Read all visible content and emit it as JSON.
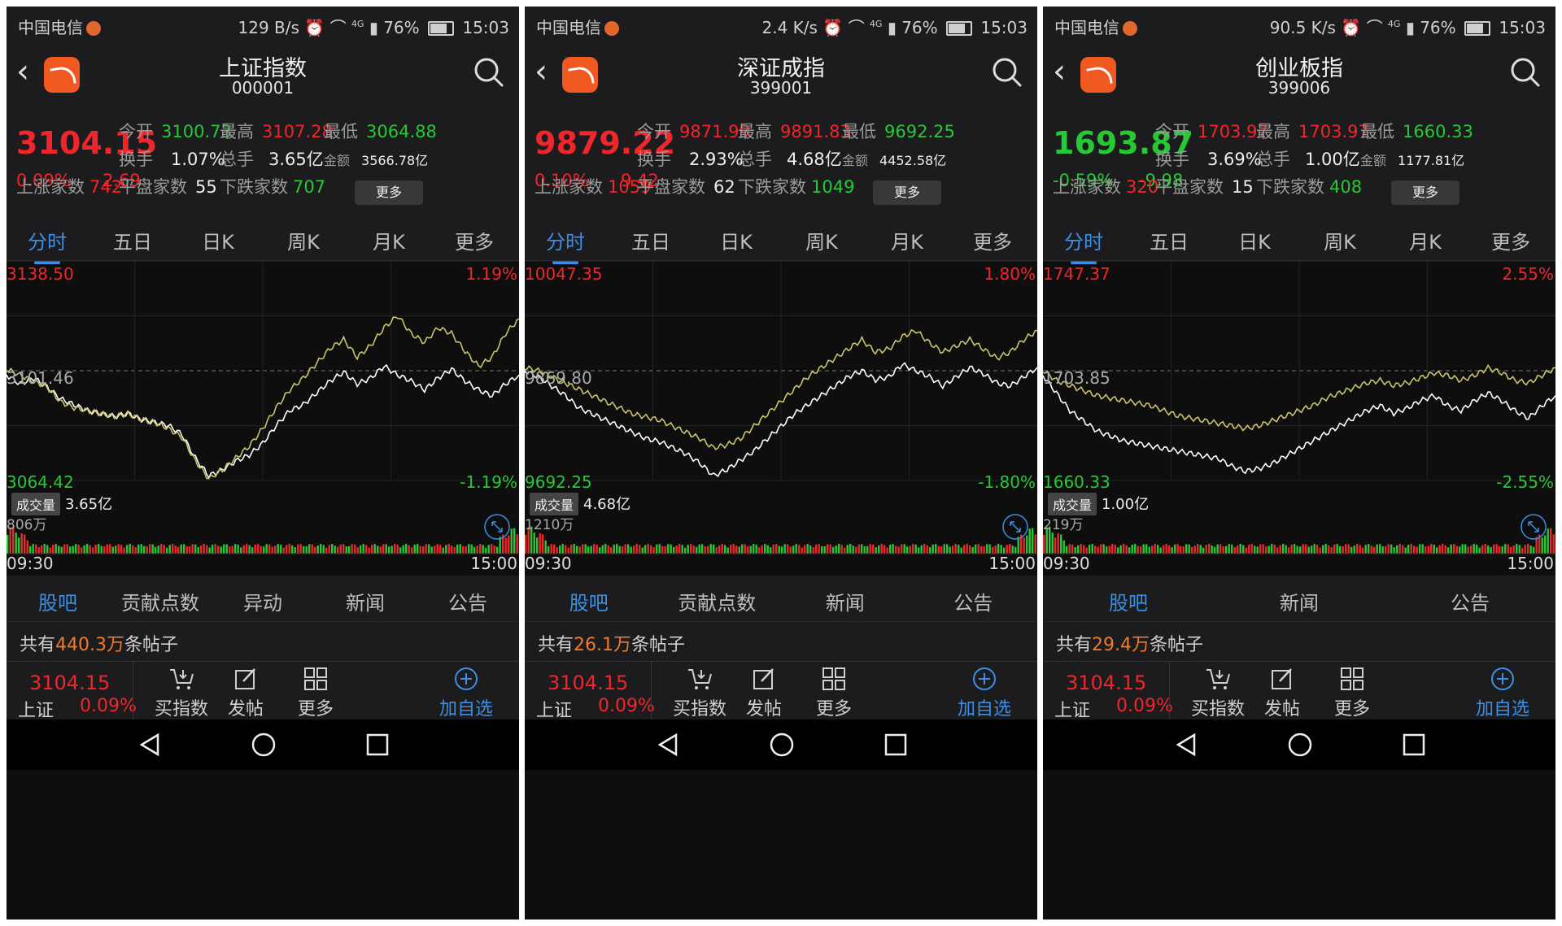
{
  "colors": {
    "up": "#f0262b",
    "down": "#26c934",
    "accent": "#3d8fe6",
    "white_line": "#ffffff",
    "yellow_line": "#c9c36a"
  },
  "common": {
    "carrier": "中国电信",
    "battery": "76%",
    "time": "15:03",
    "network": "4G",
    "stat_labels": {
      "open": "今开",
      "high": "最高",
      "low": "最低",
      "turnover_rate": "换手",
      "total_vol": "总手",
      "amount": "金额",
      "up_count": "上涨家数",
      "flat_count": "平盘家数",
      "down_count": "下跌家数"
    },
    "more_button": "更多",
    "chart_tabs": [
      "分时",
      "五日",
      "日K",
      "周K",
      "月K",
      "更多"
    ],
    "volume_label": "成交量",
    "time_start": "09:30",
    "time_end": "15:00",
    "posts_prefix": "共有",
    "posts_suffix": "条帖子",
    "action_bar": {
      "price": "3104.15",
      "name": "上证",
      "pct": "0.09%",
      "buy": "买指数",
      "post": "发帖",
      "more": "更多",
      "add": "加自选"
    },
    "icons": [
      "back-icon",
      "app-logo-icon",
      "search-icon",
      "expand-icon",
      "cart-icon",
      "edit-icon",
      "grid-icon",
      "plus-circle-icon",
      "nav-back-icon",
      "nav-home-icon",
      "nav-recent-icon"
    ]
  },
  "panels": [
    {
      "speed": "129 B/s",
      "title": "上证指数",
      "code": "000001",
      "price": "3104.15",
      "pct": "0.09%",
      "change": "2.69",
      "price_dir": "up",
      "open": "3100.73",
      "open_dir": "down",
      "high": "3107.28",
      "high_dir": "up",
      "low": "3064.88",
      "low_dir": "down",
      "turnover_rate": "1.07%",
      "total_vol": "3.65亿",
      "amount": "3566.78亿",
      "up_count": "742",
      "flat_count": "55",
      "down_count": "707",
      "chart_max": "3138.50",
      "chart_mid": "3101.46",
      "chart_min": "3064.42",
      "pct_max": "1.19%",
      "pct_min": "-1.19%",
      "volume": "3.65亿",
      "vol_max": "806万",
      "bottom_tabs": [
        "股吧",
        "贡献点数",
        "异动",
        "新闻",
        "公告"
      ],
      "posts_count": "440.3万",
      "chart_data": {
        "type": "line",
        "x": [
          "09:30",
          "15:00"
        ],
        "ylim": [
          3064.42,
          3138.5
        ],
        "prev_close": 3101.46,
        "series": [
          {
            "values": [
              3100,
              3097,
              3099,
              3096,
              3092,
              3090,
              3088,
              3087,
              3086,
              3087,
              3085,
              3084,
              3083,
              3080,
              3072,
              3066,
              3068,
              3071,
              3073,
              3077,
              3083,
              3088,
              3090,
              3094,
              3098,
              3101,
              3097,
              3099,
              3103,
              3100,
              3098,
              3095,
              3099,
              3102,
              3098,
              3095,
              3093,
              3097,
              3100
            ]
          },
          {
            "values": [
              3102,
              3100,
              3098,
              3096,
              3091,
              3089,
              3088,
              3087,
              3086,
              3087,
              3085,
              3084,
              3082,
              3079,
              3071,
              3065,
              3068,
              3072,
              3076,
              3082,
              3089,
              3095,
              3099,
              3104,
              3109,
              3112,
              3106,
              3110,
              3116,
              3120,
              3114,
              3111,
              3116,
              3114,
              3108,
              3103,
              3106,
              3114,
              3119
            ]
          }
        ]
      }
    },
    {
      "speed": "2.4 K/s",
      "title": "深证成指",
      "code": "399001",
      "price": "9879.22",
      "pct": "0.10%",
      "change": "9.42",
      "price_dir": "up",
      "open": "9871.99",
      "open_dir": "up",
      "high": "9891.83",
      "high_dir": "up",
      "low": "9692.25",
      "low_dir": "down",
      "turnover_rate": "2.93%",
      "total_vol": "4.68亿",
      "amount": "4452.58亿",
      "up_count": "1059",
      "flat_count": "62",
      "down_count": "1049",
      "chart_max": "10047.35",
      "chart_mid": "9869.80",
      "chart_min": "9692.25",
      "pct_max": "1.80%",
      "pct_min": "-1.80%",
      "volume": "4.68亿",
      "vol_max": "1210万",
      "bottom_tabs": [
        "股吧",
        "贡献点数",
        "新闻",
        "公告"
      ],
      "posts_count": "26.1万",
      "chart_data": {
        "type": "line",
        "x": [
          "09:30",
          "15:00"
        ],
        "ylim": [
          9692.25,
          10047.35
        ],
        "prev_close": 9869.8,
        "series": [
          {
            "values": [
              9870,
              9860,
              9845,
              9830,
              9810,
              9800,
              9790,
              9780,
              9770,
              9760,
              9755,
              9745,
              9735,
              9720,
              9700,
              9710,
              9725,
              9740,
              9760,
              9780,
              9800,
              9815,
              9830,
              9845,
              9860,
              9870,
              9855,
              9860,
              9880,
              9870,
              9860,
              9845,
              9860,
              9875,
              9865,
              9850,
              9845,
              9860,
              9875
            ]
          },
          {
            "values": [
              9875,
              9870,
              9860,
              9850,
              9840,
              9830,
              9820,
              9810,
              9800,
              9795,
              9790,
              9780,
              9770,
              9760,
              9745,
              9750,
              9760,
              9780,
              9800,
              9820,
              9840,
              9860,
              9875,
              9890,
              9905,
              9920,
              9900,
              9905,
              9925,
              9935,
              9915,
              9900,
              9910,
              9920,
              9905,
              9890,
              9900,
              9920,
              9935
            ]
          }
        ]
      }
    },
    {
      "speed": "90.5 K/s",
      "title": "创业板指",
      "code": "399006",
      "price": "1693.87",
      "pct": "-0.59%",
      "change": "-9.98",
      "price_dir": "down",
      "open": "1703.97",
      "open_dir": "up",
      "high": "1703.97",
      "high_dir": "up",
      "low": "1660.33",
      "low_dir": "down",
      "turnover_rate": "3.69%",
      "total_vol": "1.00亿",
      "amount": "1177.81亿",
      "up_count": "320",
      "flat_count": "15",
      "down_count": "408",
      "chart_max": "1747.37",
      "chart_mid": "1703.85",
      "chart_min": "1660.33",
      "pct_max": "2.55%",
      "pct_min": "-2.55%",
      "volume": "1.00亿",
      "vol_max": "219万",
      "bottom_tabs": [
        "股吧",
        "新闻",
        "公告"
      ],
      "posts_count": "29.4万",
      "chart_data": {
        "type": "line",
        "x": [
          "09:30",
          "15:00"
        ],
        "ylim": [
          1660.33,
          1747.37
        ],
        "prev_close": 1703.85,
        "series": [
          {
            "values": [
              1702,
              1695,
              1688,
              1684,
              1680,
              1678,
              1676,
              1675,
              1674,
              1673,
              1672,
              1671,
              1670,
              1669,
              1666,
              1664,
              1665,
              1667,
              1670,
              1673,
              1676,
              1679,
              1682,
              1685,
              1688,
              1690,
              1687,
              1689,
              1692,
              1694,
              1690,
              1688,
              1692,
              1695,
              1692,
              1688,
              1685,
              1690,
              1694
            ]
          },
          {
            "values": [
              1704,
              1700,
              1698,
              1696,
              1694,
              1693,
              1692,
              1691,
              1690,
              1688,
              1686,
              1685,
              1684,
              1683,
              1682,
              1681,
              1682,
              1684,
              1686,
              1688,
              1690,
              1693,
              1695,
              1697,
              1699,
              1700,
              1698,
              1699,
              1701,
              1703,
              1702,
              1700,
              1702,
              1705,
              1703,
              1700,
              1699,
              1702,
              1705
            ]
          }
        ]
      }
    }
  ]
}
